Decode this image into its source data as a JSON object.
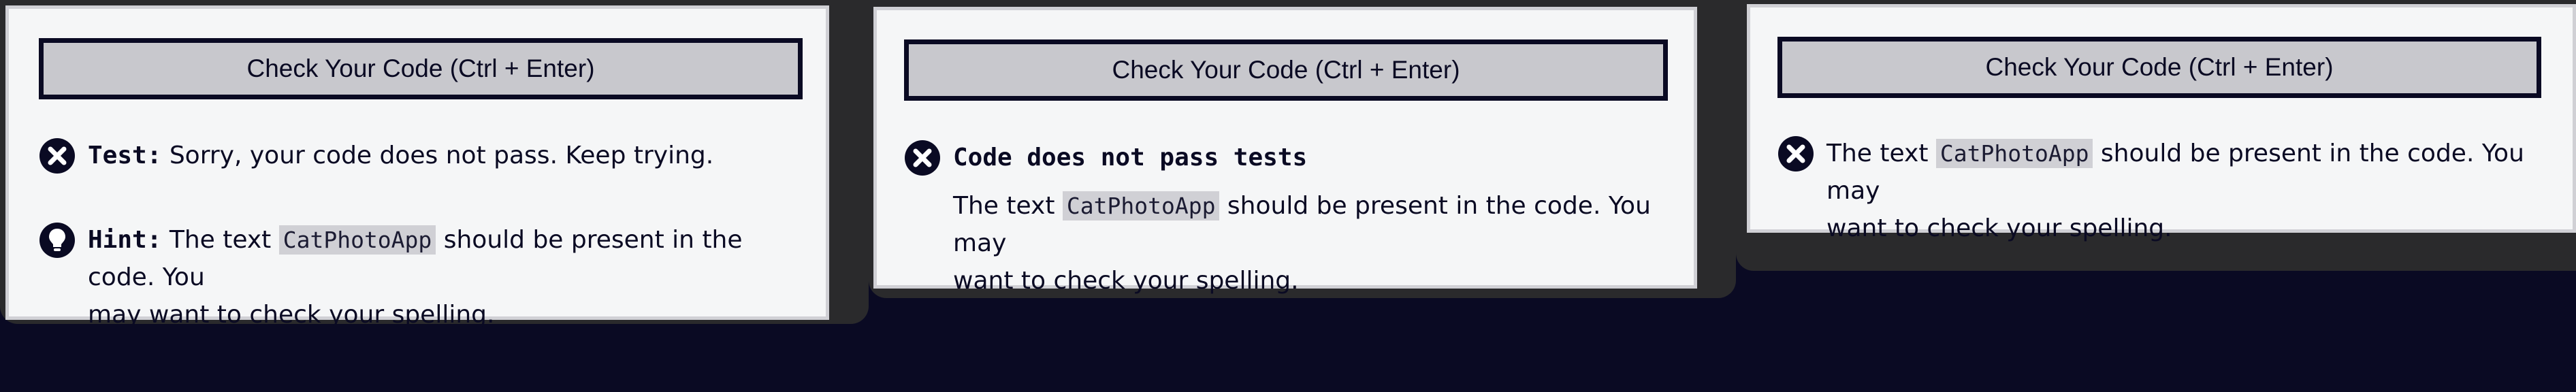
{
  "check_button_label": "Check Your Code (Ctrl + Enter)",
  "panels": [
    {
      "test_label": "Test:",
      "test_text": "Sorry, your code does not pass. Keep trying.",
      "hint_label": "Hint:",
      "hint_before": "The text",
      "hint_code": "CatPhotoApp",
      "hint_after_line1": "should be present in the code. You",
      "hint_after_line2": "may want to check your spelling."
    },
    {
      "title": "Code does not pass tests",
      "text_before": "The text",
      "code": "CatPhotoApp",
      "text_after_line1": "should be present in the code. You may",
      "text_after_line2": "want to check your spelling."
    },
    {
      "text_before": "The text",
      "code": "CatPhotoApp",
      "text_after_line1": "should be present in the code. You may",
      "text_after_line2": "want to check your spelling."
    }
  ],
  "icons": {
    "fail": "x-circle-icon",
    "hint": "lightbulb-icon"
  },
  "colors": {
    "background": "#0a0a23",
    "button": "#c8c8cd",
    "panel": "#f5f6f7",
    "code_bg": "#d0d0d5"
  }
}
